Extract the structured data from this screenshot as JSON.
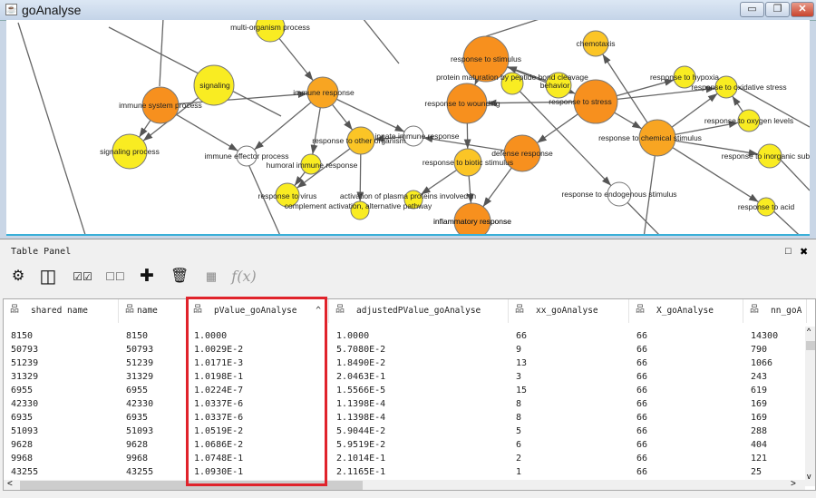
{
  "window": {
    "title": "goAnalyse",
    "minimize": "▭",
    "restore": "❐",
    "close": "✕"
  },
  "graph": {
    "colors": {
      "orange": "#f7901e",
      "light_orange": "#f8a522",
      "amber": "#fbc526",
      "yellow": "#f9ec22",
      "white": "#ffffff"
    },
    "nodes": [
      "multi-organism process",
      "immune system process",
      "signaling",
      "signaling process",
      "immune response",
      "immune effector process",
      "response to other organism",
      "humoral immune response",
      "innate immune response",
      "response to virus",
      "activation of plasma proteins involved in",
      "complement activation, alternative pathway",
      "response to stimulus",
      "protein maturation by peptide bond cleavage",
      "behavior",
      "response to wounding",
      "chemotaxis",
      "response to stress",
      "response to hypoxia",
      "response to oxidative stress",
      "response to oxygen levels",
      "response to chemical stimulus",
      "response to inorganic substance",
      "response to biotic stimulus",
      "defense response",
      "response to endogenous stimulus",
      "response to acid",
      "inflammatory response",
      "inflammatory response"
    ]
  },
  "panel": {
    "title": "Table Panel",
    "float_icon": "□",
    "close_icon": "✖"
  },
  "toolbar": {
    "settings": "⚙",
    "layout": "◫",
    "select_all": "☑☑",
    "deselect_all": "☐☐",
    "add": "✚",
    "delete": "🗑",
    "link": "▦",
    "function": "f(x)"
  },
  "table": {
    "columns": [
      "shared name",
      "name",
      "pValue_goAnalyse",
      "adjustedPValue_goAnalyse",
      "xx_goAnalyse",
      "X_goAnalyse",
      "nn_goA"
    ],
    "sort_indicator": "^",
    "rows": [
      [
        "8150",
        "8150",
        "1.0000",
        "1.0000",
        "66",
        "66",
        "14300"
      ],
      [
        "50793",
        "50793",
        "1.0029E-2",
        "5.7080E-2",
        "9",
        "66",
        "790"
      ],
      [
        "51239",
        "51239",
        "1.0171E-3",
        "1.8490E-2",
        "13",
        "66",
        "1066"
      ],
      [
        "31329",
        "31329",
        "1.0198E-1",
        "2.0463E-1",
        "3",
        "66",
        "243"
      ],
      [
        "6955",
        "6955",
        "1.0224E-7",
        "1.5566E-5",
        "15",
        "66",
        "619"
      ],
      [
        "42330",
        "42330",
        "1.0337E-6",
        "1.1398E-4",
        "8",
        "66",
        "169"
      ],
      [
        "6935",
        "6935",
        "1.0337E-6",
        "1.1398E-4",
        "8",
        "66",
        "169"
      ],
      [
        "51093",
        "51093",
        "1.0519E-2",
        "5.9044E-2",
        "5",
        "66",
        "288"
      ],
      [
        "9628",
        "9628",
        "1.0686E-2",
        "5.9519E-2",
        "6",
        "66",
        "404"
      ],
      [
        "9968",
        "9968",
        "1.0748E-1",
        "2.1014E-1",
        "2",
        "66",
        "121"
      ],
      [
        "43255",
        "43255",
        "1.0930E-1",
        "2.1165E-1",
        "1",
        "66",
        "25"
      ]
    ]
  },
  "scroll": {
    "left": "<",
    "right": ">",
    "up": "^",
    "down": "v"
  }
}
